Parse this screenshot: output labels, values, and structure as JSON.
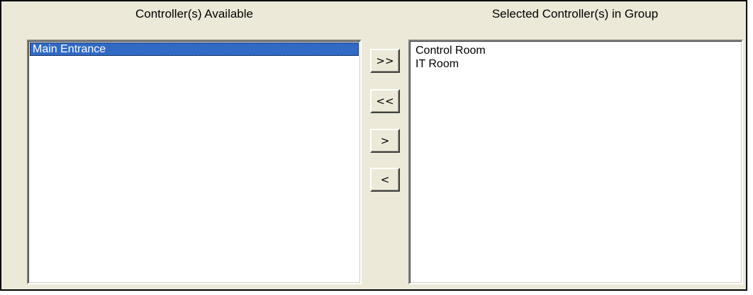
{
  "available": {
    "heading": "Controller(s) Available",
    "items": [
      "Main Entrance"
    ],
    "selected_item": "Main Entrance"
  },
  "selected_group": {
    "heading": "Selected Controller(s) in Group",
    "items": [
      "Control Room",
      "IT Room"
    ]
  },
  "buttons": {
    "add_all": ">>",
    "remove_all": "<<",
    "add_one": ">",
    "remove_one": "<"
  },
  "colors": {
    "panel_background": "#ece9d8",
    "selection_highlight": "#316ac5"
  }
}
